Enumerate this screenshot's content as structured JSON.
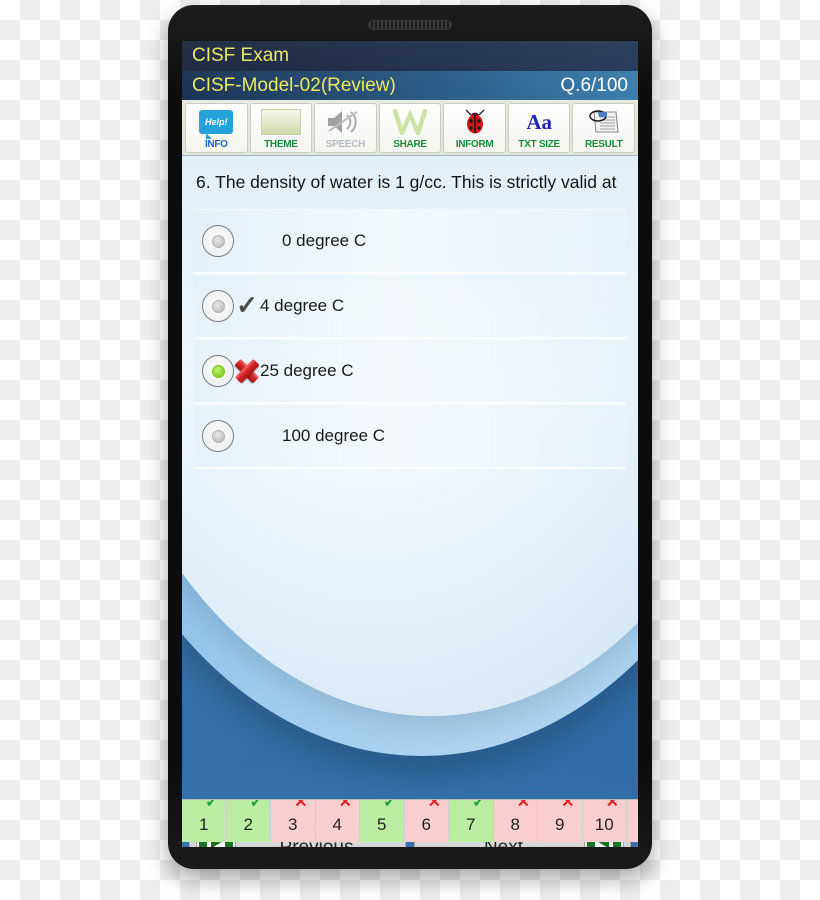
{
  "app": {
    "title": "CISF Exam",
    "model": "CISF-Model-02(Review)",
    "question_counter": "Q.6/100"
  },
  "toolbar": {
    "buttons": [
      {
        "label": "INFO",
        "icon": "help-icon",
        "glyph": "Help!"
      },
      {
        "label": "THEME",
        "icon": "theme-icon",
        "glyph": ""
      },
      {
        "label": "SPEECH",
        "icon": "speaker-mute-icon",
        "glyph": ""
      },
      {
        "label": "SHARE",
        "icon": "share-icon",
        "glyph": "W"
      },
      {
        "label": "INFORM",
        "icon": "ladybug-icon",
        "glyph": ""
      },
      {
        "label": "TXT SIZE",
        "icon": "font-size-icon",
        "glyph": "Aa"
      },
      {
        "label": "RESULT",
        "icon": "result-sheet-icon",
        "glyph": ""
      }
    ]
  },
  "question": {
    "number": "6.",
    "text": "6.  The density of water is 1 g/cc. This is strictly valid at",
    "options": [
      {
        "label": "0 degree C",
        "selected": false,
        "mark": "none"
      },
      {
        "label": "4 degree C",
        "selected": false,
        "mark": "tick"
      },
      {
        "label": "25 degree C",
        "selected": true,
        "mark": "cross"
      },
      {
        "label": "100 degree C",
        "selected": false,
        "mark": "none"
      }
    ]
  },
  "nav": {
    "previous_label": "Previous",
    "next_label": "Next",
    "previous_icon": "skip-to-start-icon",
    "next_icon": "skip-to-end-icon"
  },
  "qstrip": {
    "cells": [
      {
        "number": "1",
        "state": "green",
        "mark": "ok"
      },
      {
        "number": "2",
        "state": "green",
        "mark": "ok"
      },
      {
        "number": "3",
        "state": "pink",
        "mark": "no"
      },
      {
        "number": "4",
        "state": "pink",
        "mark": "no"
      },
      {
        "number": "5",
        "state": "green",
        "mark": "ok"
      },
      {
        "number": "6",
        "state": "pink",
        "mark": "no"
      },
      {
        "number": "7",
        "state": "green",
        "mark": "ok"
      },
      {
        "number": "8",
        "state": "pink",
        "mark": "no"
      },
      {
        "number": "9",
        "state": "pink",
        "mark": "no"
      },
      {
        "number": "10",
        "state": "pink",
        "mark": "no"
      },
      {
        "number": "",
        "state": "pink",
        "mark": ""
      }
    ]
  },
  "colors": {
    "header_text": "#e8e860",
    "header_bg": "#1d263f",
    "header_bar2": "#2b5c86",
    "correct_green": "#189b3c",
    "wrong_red": "#e02020",
    "cell_green": "#b9eda0",
    "cell_pink": "#f9cdcd",
    "selected_dot": "#8fd62f",
    "nav_icon_bg": "#0f6e1c"
  }
}
